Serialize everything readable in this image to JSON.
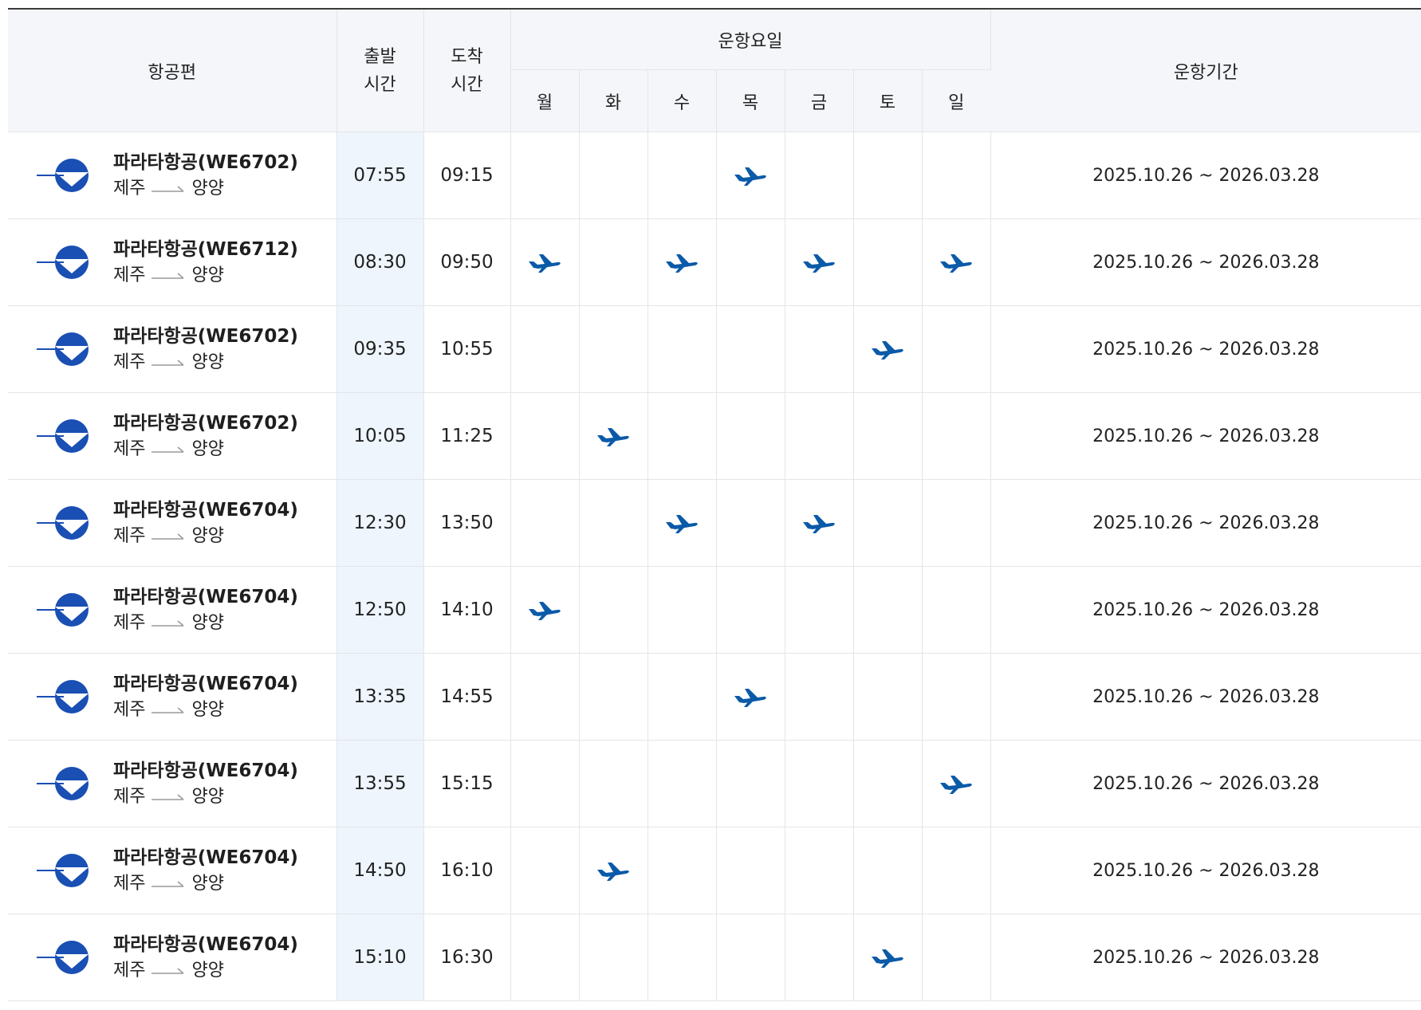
{
  "colors": {
    "accent": "#1a4fb3",
    "plane": "#0b5aa8",
    "header_bg": "#f4f6fa",
    "dep_col_bg": "#eef5fd"
  },
  "header": {
    "flight": "항공편",
    "dep_time": [
      "출발",
      "시간"
    ],
    "arr_time": [
      "도착",
      "시간"
    ],
    "days_group": "운항요일",
    "days": [
      "월",
      "화",
      "수",
      "목",
      "금",
      "토",
      "일"
    ],
    "period": "운항기간"
  },
  "rows": [
    {
      "flight": "파라타항공(WE6702)",
      "from": "제주",
      "to": "양양",
      "dep": "07:55",
      "arr": "09:15",
      "days": [
        false,
        false,
        false,
        true,
        false,
        false,
        false
      ],
      "period": "2025.10.26 ~ 2026.03.28"
    },
    {
      "flight": "파라타항공(WE6712)",
      "from": "제주",
      "to": "양양",
      "dep": "08:30",
      "arr": "09:50",
      "days": [
        true,
        false,
        true,
        false,
        true,
        false,
        true
      ],
      "period": "2025.10.26 ~ 2026.03.28"
    },
    {
      "flight": "파라타항공(WE6702)",
      "from": "제주",
      "to": "양양",
      "dep": "09:35",
      "arr": "10:55",
      "days": [
        false,
        false,
        false,
        false,
        false,
        true,
        false
      ],
      "period": "2025.10.26 ~ 2026.03.28"
    },
    {
      "flight": "파라타항공(WE6702)",
      "from": "제주",
      "to": "양양",
      "dep": "10:05",
      "arr": "11:25",
      "days": [
        false,
        true,
        false,
        false,
        false,
        false,
        false
      ],
      "period": "2025.10.26 ~ 2026.03.28"
    },
    {
      "flight": "파라타항공(WE6704)",
      "from": "제주",
      "to": "양양",
      "dep": "12:30",
      "arr": "13:50",
      "days": [
        false,
        false,
        true,
        false,
        true,
        false,
        false
      ],
      "period": "2025.10.26 ~ 2026.03.28"
    },
    {
      "flight": "파라타항공(WE6704)",
      "from": "제주",
      "to": "양양",
      "dep": "12:50",
      "arr": "14:10",
      "days": [
        true,
        false,
        false,
        false,
        false,
        false,
        false
      ],
      "period": "2025.10.26 ~ 2026.03.28"
    },
    {
      "flight": "파라타항공(WE6704)",
      "from": "제주",
      "to": "양양",
      "dep": "13:35",
      "arr": "14:55",
      "days": [
        false,
        false,
        false,
        true,
        false,
        false,
        false
      ],
      "period": "2025.10.26 ~ 2026.03.28"
    },
    {
      "flight": "파라타항공(WE6704)",
      "from": "제주",
      "to": "양양",
      "dep": "13:55",
      "arr": "15:15",
      "days": [
        false,
        false,
        false,
        false,
        false,
        false,
        true
      ],
      "period": "2025.10.26 ~ 2026.03.28"
    },
    {
      "flight": "파라타항공(WE6704)",
      "from": "제주",
      "to": "양양",
      "dep": "14:50",
      "arr": "16:10",
      "days": [
        false,
        true,
        false,
        false,
        false,
        false,
        false
      ],
      "period": "2025.10.26 ~ 2026.03.28"
    },
    {
      "flight": "파라타항공(WE6704)",
      "from": "제주",
      "to": "양양",
      "dep": "15:10",
      "arr": "16:30",
      "days": [
        false,
        false,
        false,
        false,
        false,
        true,
        false
      ],
      "period": "2025.10.26 ~ 2026.03.28"
    }
  ]
}
